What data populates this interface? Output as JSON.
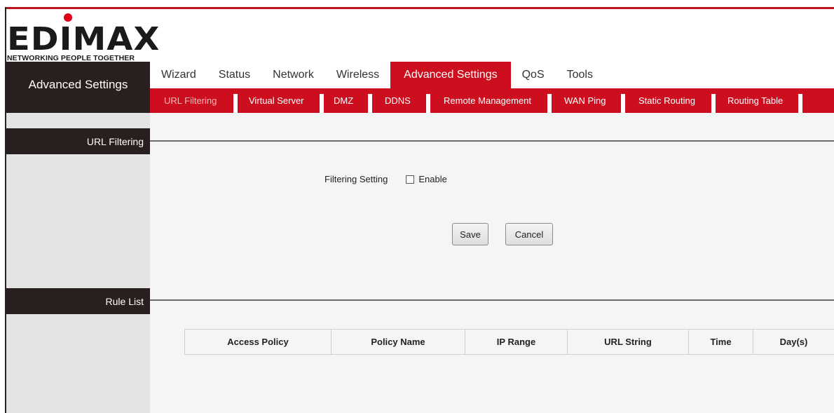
{
  "brand": {
    "wordmark": "EDIMAX",
    "tagline": "NETWORKING PEOPLE TOGETHER",
    "accent_color": "#cc0e1e"
  },
  "sidebar": {
    "title": "Advanced Settings"
  },
  "main_tabs": [
    {
      "label": "Wizard",
      "active": false
    },
    {
      "label": "Status",
      "active": false
    },
    {
      "label": "Network",
      "active": false
    },
    {
      "label": "Wireless",
      "active": false
    },
    {
      "label": "Advanced Settings",
      "active": true
    },
    {
      "label": "QoS",
      "active": false
    },
    {
      "label": "Tools",
      "active": false
    }
  ],
  "sub_tabs": [
    {
      "label": "URL Filtering",
      "active": true
    },
    {
      "label": "Virtual Server",
      "active": false
    },
    {
      "label": "DMZ",
      "active": false
    },
    {
      "label": "DDNS",
      "active": false
    },
    {
      "label": "Remote Management",
      "active": false
    },
    {
      "label": "WAN Ping",
      "active": false
    },
    {
      "label": "Static Routing",
      "active": false
    },
    {
      "label": "Routing Table",
      "active": false
    }
  ],
  "url_filtering": {
    "section_label": "URL Filtering",
    "filtering_setting_label": "Filtering Setting",
    "enable_label": "Enable",
    "enable_checked": false,
    "save_label": "Save",
    "cancel_label": "Cancel"
  },
  "rule_list": {
    "section_label": "Rule List",
    "columns": [
      "Access Policy",
      "Policy Name",
      "IP Range",
      "URL String",
      "Time",
      "Day(s)"
    ]
  }
}
